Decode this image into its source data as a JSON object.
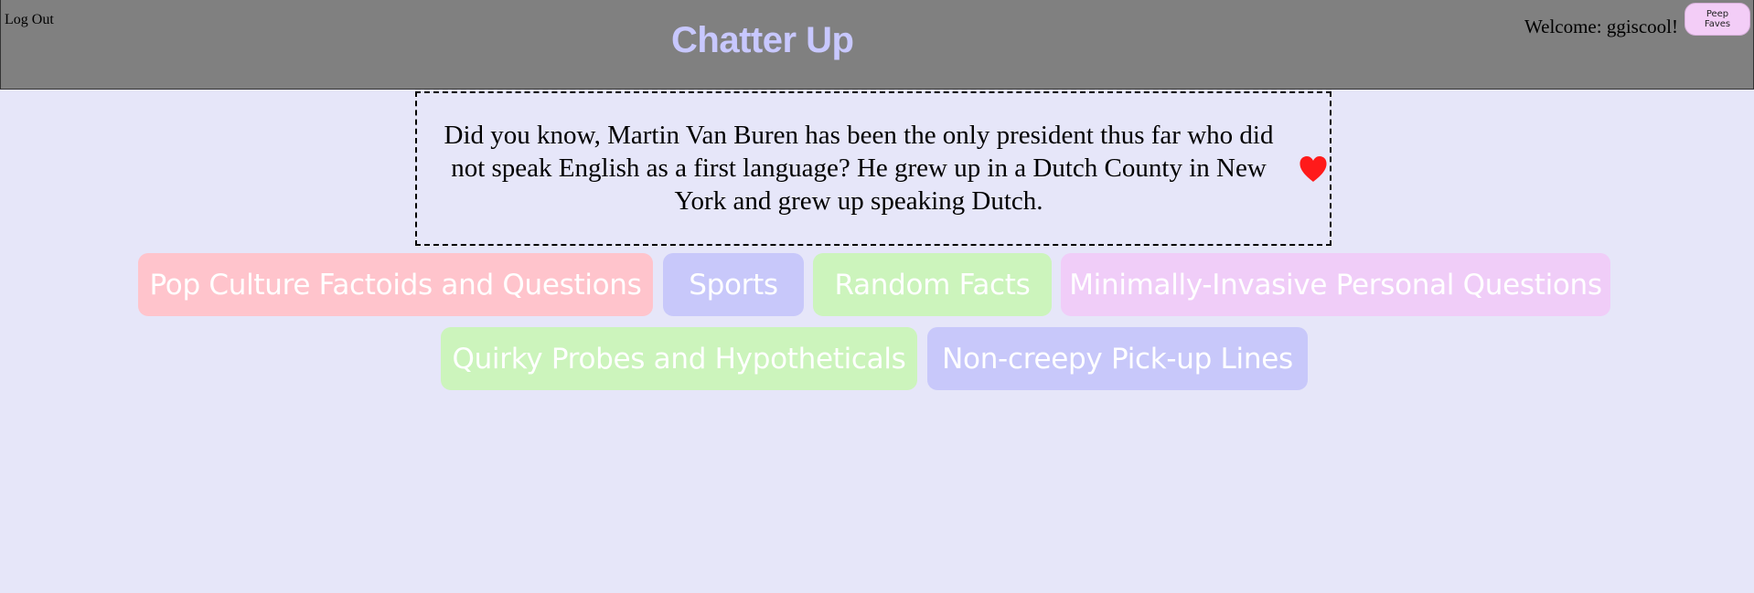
{
  "header": {
    "logout_label": "Log Out",
    "title": "Chatter Up",
    "welcome_text": "Welcome: ggiscool!",
    "peep_faves_line1": "Peep",
    "peep_faves_line2": "Faves"
  },
  "fact": {
    "text": "Did you know, Martin Van Buren has been the only president thus far who did not speak English as a first language? He grew up in a Dutch County in New York and grew up speaking Dutch.",
    "favorite_icon": "heart-icon",
    "favorite_color": "#ff1a1a"
  },
  "categories": [
    {
      "label": "Pop Culture Factoids and Questions",
      "color": "#ffc4cc"
    },
    {
      "label": "Sports",
      "color": "#c8c8fa"
    },
    {
      "label": "Random Facts",
      "color": "#ccf4bc"
    },
    {
      "label": "Minimally-Invasive Personal Questions",
      "color": "#f0cdf8"
    },
    {
      "label": "Quirky Probes and Hypotheticals",
      "color": "#ccf4bc"
    },
    {
      "label": "Non-creepy Pick-up Lines",
      "color": "#c8c8fa"
    }
  ],
  "colors": {
    "background": "#e6e6f9",
    "header": "#808080",
    "title": "#c8c8ff"
  }
}
